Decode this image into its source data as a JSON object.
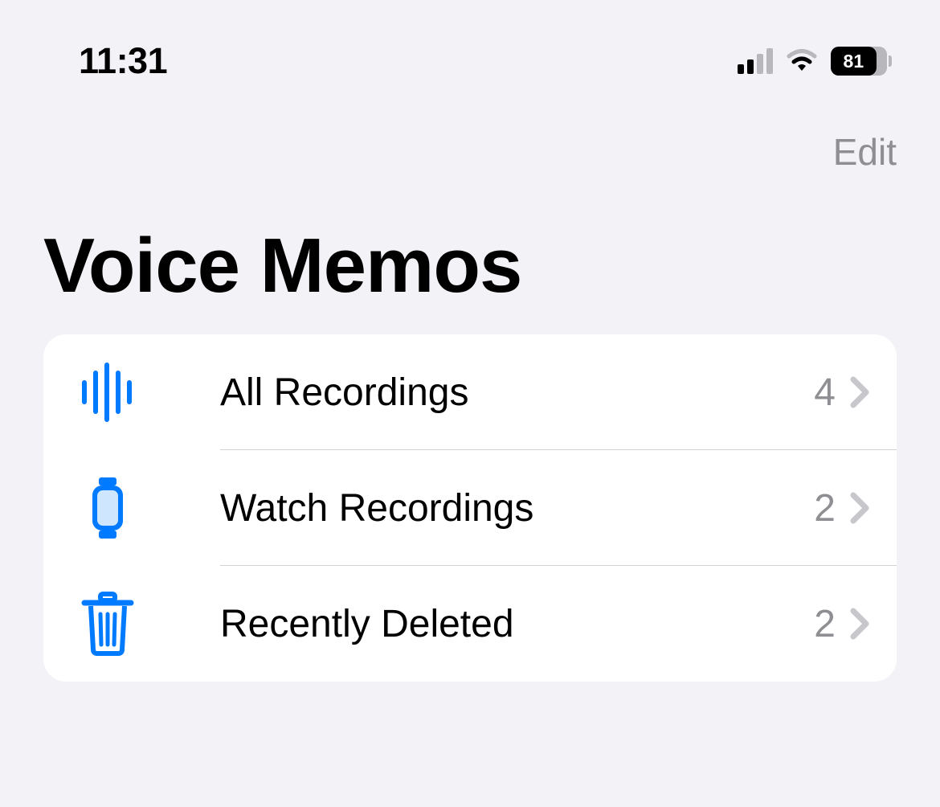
{
  "status_bar": {
    "time": "11:31",
    "battery_percent": "81"
  },
  "nav": {
    "edit_label": "Edit"
  },
  "page": {
    "title": "Voice Memos"
  },
  "list": {
    "items": [
      {
        "label": "All Recordings",
        "count": "4",
        "icon": "waveform-icon"
      },
      {
        "label": "Watch Recordings",
        "count": "2",
        "icon": "watch-icon"
      },
      {
        "label": "Recently Deleted",
        "count": "2",
        "icon": "trash-icon"
      }
    ]
  },
  "colors": {
    "accent": "#007aff",
    "secondary": "#8e8e93"
  }
}
